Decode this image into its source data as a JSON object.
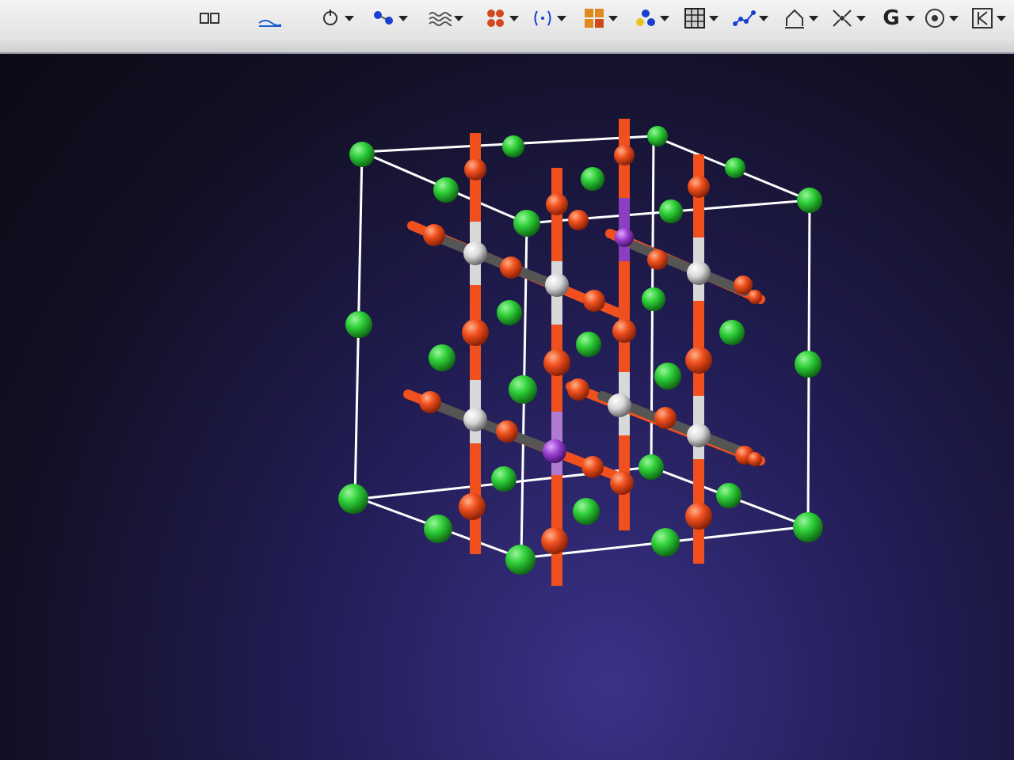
{
  "toolbar": {
    "buttons": [
      {
        "name": "select-icon"
      },
      {
        "name": "box-icon"
      },
      {
        "name": "surface-icon"
      },
      {
        "name": "rotate-icon"
      },
      {
        "name": "atoms-bonds-icon"
      },
      {
        "name": "waves-icon"
      },
      {
        "name": "cluster-icon"
      },
      {
        "name": "bracket-icon"
      },
      {
        "name": "element-grid-icon"
      },
      {
        "name": "molecule-icon"
      },
      {
        "name": "lattice-icon"
      },
      {
        "name": "chain-icon"
      },
      {
        "name": "polyhedron-icon"
      },
      {
        "name": "symmetry-icon"
      },
      {
        "name": "gaussian-icon",
        "glyph": "G"
      },
      {
        "name": "target-icon"
      },
      {
        "name": "crystal-k-icon"
      }
    ]
  },
  "colors": {
    "green_atom": "#2fd03a",
    "orange_atom": "#f0501e",
    "white_atom": "#d8d8d8",
    "purple_atom": "#9a3fd0",
    "cell_edge": "#ffffff"
  }
}
